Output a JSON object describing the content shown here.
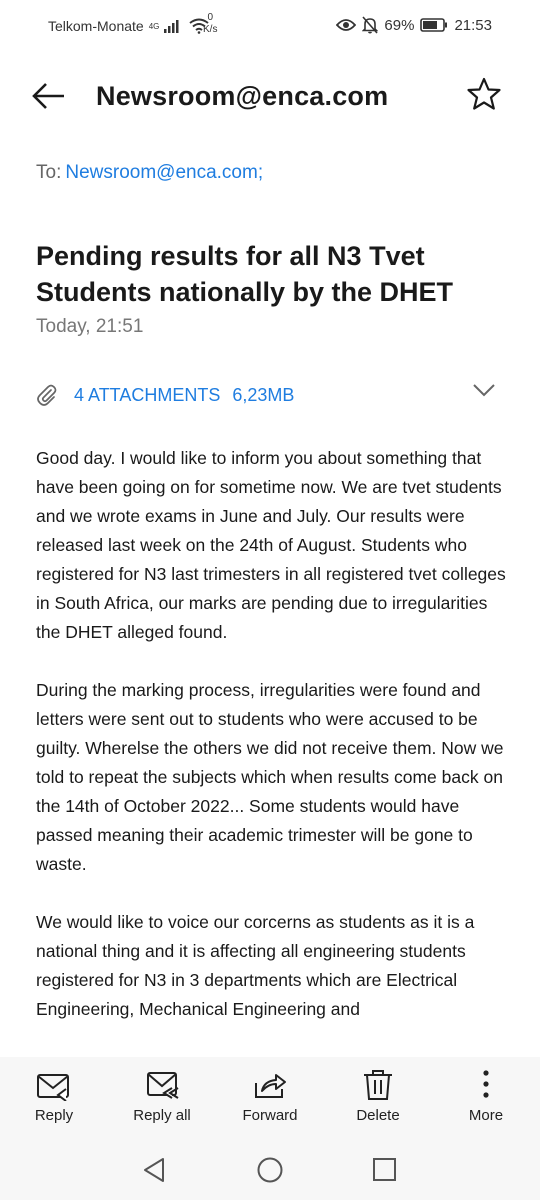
{
  "status": {
    "carrier": "Telkom-Monate",
    "network": "4G",
    "speed_value": "0",
    "speed_unit": "K/s",
    "battery": "69%",
    "time": "21:53"
  },
  "appbar": {
    "title": "Newsroom@enca.com"
  },
  "email": {
    "to_label": "To:",
    "to_address": "Newsroom@enca.com;",
    "subject": "Pending results for all N3 Tvet Students nationally by the DHET",
    "date": "Today, 21:51",
    "attachments_label": "4 ATTACHMENTS",
    "attachments_size": "6,23MB",
    "body": [
      "Good day. I would like to inform you about something that have been going on for sometime now. We are tvet students and we wrote exams in June and July. Our results were released last week on the 24th of August. Students who registered for N3 last trimesters in all  registered tvet colleges in South Africa, our marks are pending due to irregularities the DHET alleged found.",
      "During the marking process, irregularities were found and letters were sent out to students who were accused to be guilty. Wherelse the others we did not receive them. Now we told to repeat the subjects which when results come back on the 14th of October 2022... Some students would have passed meaning their academic trimester will be gone to waste.",
      "We would like to voice our corcerns as students as it is a national thing and it is affecting all engineering students registered for N3 in 3 departments which are Electrical Engineering, Mechanical Engineering and"
    ]
  },
  "actions": {
    "reply": "Reply",
    "reply_all": "Reply all",
    "forward": "Forward",
    "delete": "Delete",
    "more": "More"
  },
  "colors": {
    "accent": "#1f7de0",
    "bar_bg": "#f7f7f7"
  }
}
